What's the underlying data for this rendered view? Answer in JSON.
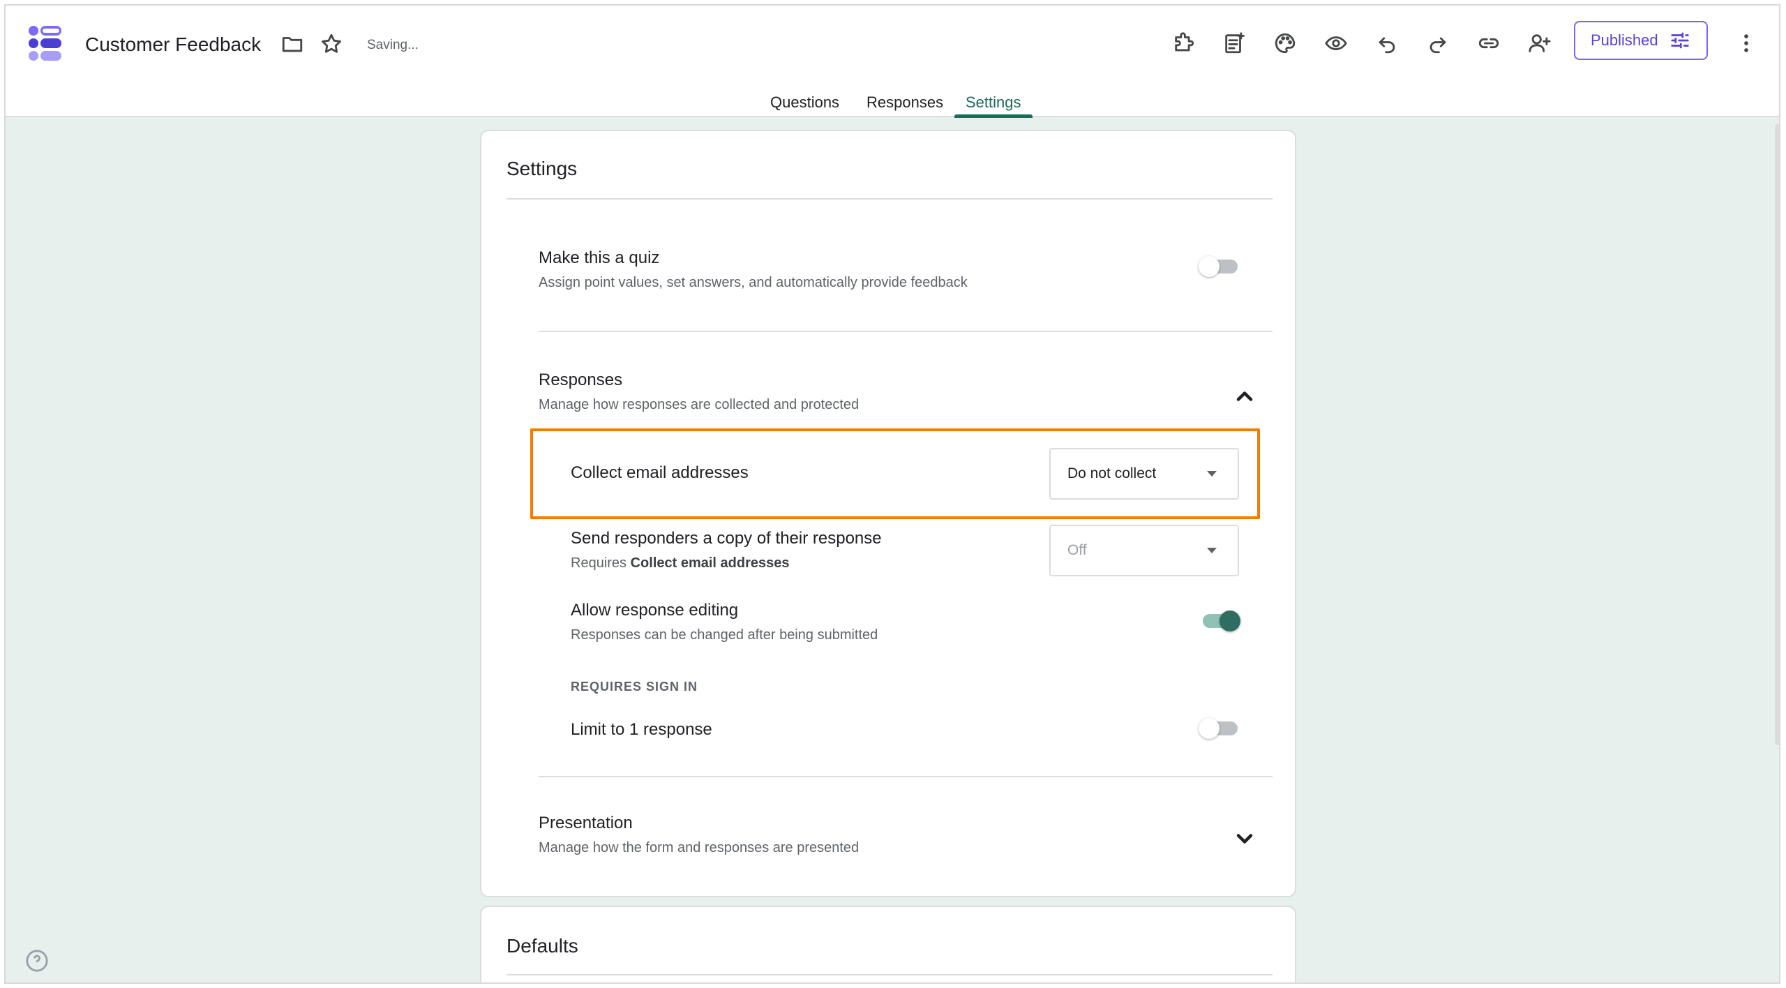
{
  "header": {
    "title": "Customer Feedback",
    "status": "Saving...",
    "publish_label": "Published"
  },
  "tabs": [
    {
      "label": "Questions"
    },
    {
      "label": "Responses"
    },
    {
      "label": "Settings"
    }
  ],
  "settings_card": {
    "title": "Settings",
    "quiz": {
      "title": "Make this a quiz",
      "subtitle": "Assign point values, set answers, and automatically provide feedback",
      "enabled": false
    },
    "responses": {
      "title": "Responses",
      "subtitle": "Manage how responses are collected and protected",
      "expanded": true,
      "collect_email": {
        "label": "Collect email addresses",
        "value": "Do not collect"
      },
      "send_copy": {
        "label": "Send responders a copy of their response",
        "sub_prefix": "Requires",
        "sub_bold": "Collect email addresses",
        "value": "Off"
      },
      "allow_editing": {
        "label": "Allow response editing",
        "subtitle": "Responses can be changed after being submitted",
        "enabled": true
      },
      "requires_sign_in_label": "REQUIRES SIGN IN",
      "limit_one": {
        "label": "Limit to 1 response",
        "enabled": false
      }
    },
    "presentation": {
      "title": "Presentation",
      "subtitle": "Manage how the form and responses are presented",
      "expanded": false
    }
  },
  "defaults_card": {
    "title": "Defaults"
  },
  "colors": {
    "accent": "#1a6b5a",
    "highlight": "#f57c00",
    "publish": "#5b3fd6",
    "background": "#e8f0ee"
  }
}
